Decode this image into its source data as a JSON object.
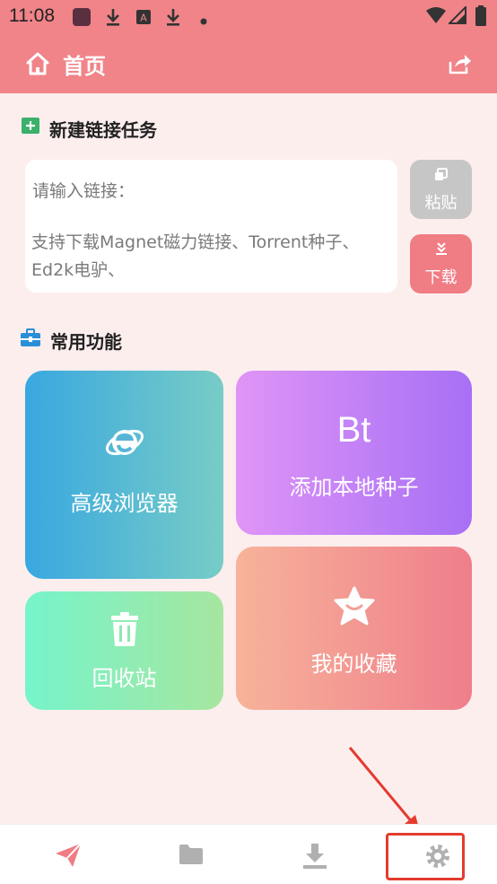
{
  "status_bar": {
    "time": "11:08"
  },
  "app_bar": {
    "title": "首页",
    "home_icon": "home-icon",
    "share_icon": "share-icon"
  },
  "new_task": {
    "title": "新建链接任务",
    "placeholder_1": "请输入链接：",
    "placeholder_2": "支持下载Magnet磁力链接、Torrent种子、Ed2k电驴、",
    "paste_label": "粘贴",
    "download_label": "下载"
  },
  "common_functions": {
    "title": "常用功能",
    "cards": [
      {
        "label": "高级浏览器",
        "icon": "ie-browser-icon"
      },
      {
        "label": "添加本地种子",
        "icon_text": "Bt"
      },
      {
        "label": "回收站",
        "icon": "trash-icon"
      },
      {
        "label": "我的收藏",
        "icon": "star-icon"
      }
    ]
  },
  "bottom_nav": [
    {
      "icon": "send-icon",
      "active": true
    },
    {
      "icon": "folder-icon",
      "active": false
    },
    {
      "icon": "download-icon",
      "active": false
    },
    {
      "icon": "settings-gear-icon",
      "active": false
    }
  ],
  "colors": {
    "primary": "#f08489",
    "page_bg": "#fdeeee",
    "annotation": "#e53b2f"
  }
}
